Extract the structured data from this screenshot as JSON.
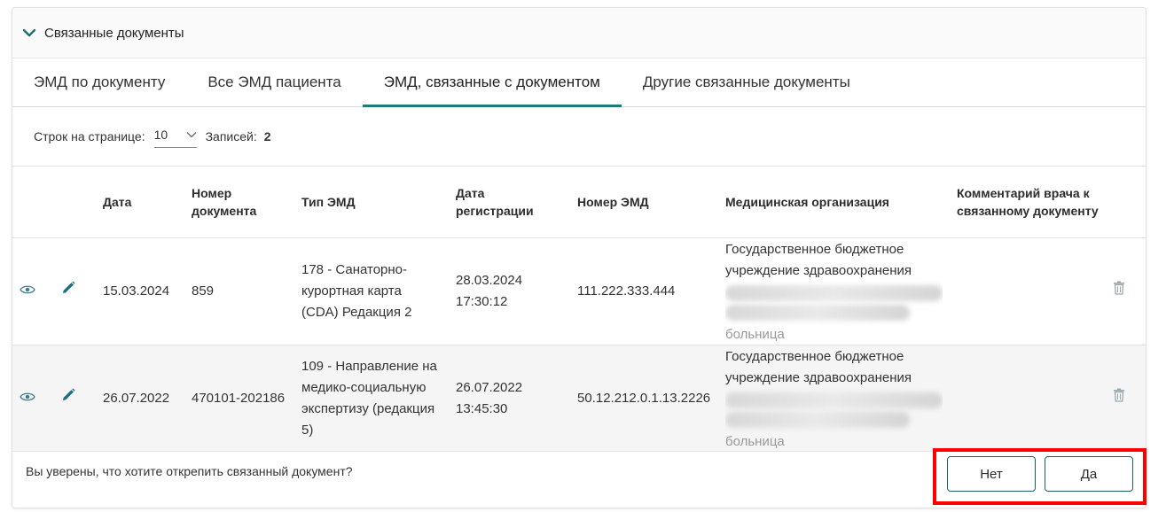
{
  "panel": {
    "title": "Связанные документы"
  },
  "tabs": [
    {
      "label": "ЭМД по документу"
    },
    {
      "label": "Все ЭМД пациента"
    },
    {
      "label": "ЭМД, связанные с документом",
      "active": true
    },
    {
      "label": "Другие связанные документы"
    }
  ],
  "toolbar": {
    "rows_label": "Строк на странице:",
    "rows_value": "10",
    "records_label": "Записей:",
    "records_count": "2"
  },
  "table": {
    "headers": [
      "Дата",
      "Номер документа",
      "Тип ЭМД",
      "Дата регистрации",
      "Номер ЭМД",
      "Медицинская организация",
      "Комментарий врача к связанному документу"
    ],
    "rows": [
      {
        "date": "15.03.2024",
        "doc_number": "859",
        "emd_type": "178 - Санаторно-курортная карта (CDA) Редакция 2",
        "reg_date": "28.03.2024 17:30:12",
        "emd_number": "111.222.333.444",
        "org": "Государственное бюджетное учреждение здравоохранения",
        "org_tail": "больница",
        "comment": ""
      },
      {
        "date": "26.07.2022",
        "doc_number": "470101-202186",
        "emd_type": "109 - Направление на медико-социальную экспертизу (редакция 5)",
        "reg_date": "26.07.2022 13:45:30",
        "emd_number": "50.12.212.0.1.13.2226",
        "org": "Государственное бюджетное учреждение здравоохранения",
        "org_tail": "больница",
        "comment": ""
      }
    ]
  },
  "confirm": {
    "question": "Вы уверены, что хотите открепить связанный документ?",
    "no_label": "Нет",
    "yes_label": "Да"
  },
  "colors": {
    "accent": "#1c7a7a",
    "icon": "#1f6d80",
    "highlight": "#ff0000"
  },
  "icons": [
    "chevron-down-icon",
    "eye-icon",
    "pencil-icon",
    "trash-icon"
  ]
}
